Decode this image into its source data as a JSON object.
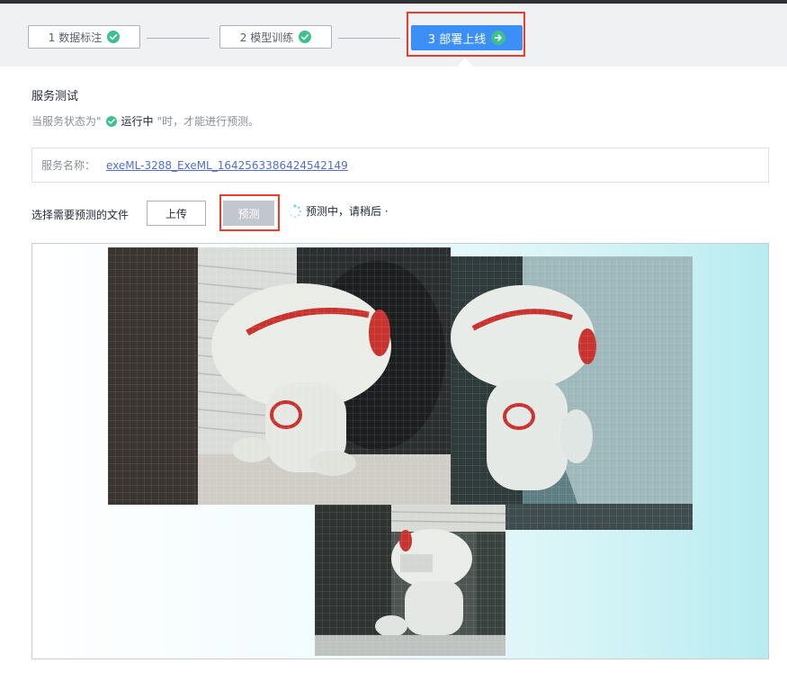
{
  "steps": [
    {
      "label": "1 数据标注",
      "state": "completed"
    },
    {
      "label": "2 模型训练",
      "state": "completed"
    },
    {
      "label": "3 部署上线",
      "state": "current"
    }
  ],
  "section": {
    "title": "服务测试",
    "note_prefix": "当服务状态为\"",
    "note_status": "运行中",
    "note_suffix": "\"时，才能进行预测。"
  },
  "service": {
    "label": "服务名称：",
    "name": "exeML-3288_ExeML_1642563386424542149"
  },
  "predict": {
    "choose_label": "选择需要预测的文件",
    "upload_label": "上传",
    "predict_label": "预测",
    "status_text": "预测中，请稍后 ·"
  },
  "images": [
    {
      "name": "plush-toy-photo-1",
      "icon": "photo"
    },
    {
      "name": "plush-toy-photo-2",
      "icon": "photo"
    },
    {
      "name": "plush-toy-photo-3",
      "icon": "photo"
    }
  ],
  "colors": {
    "accent": "#3b8ff6",
    "success": "#3ec08e",
    "highlight": "#ea3d30",
    "link": "#526ecc"
  }
}
